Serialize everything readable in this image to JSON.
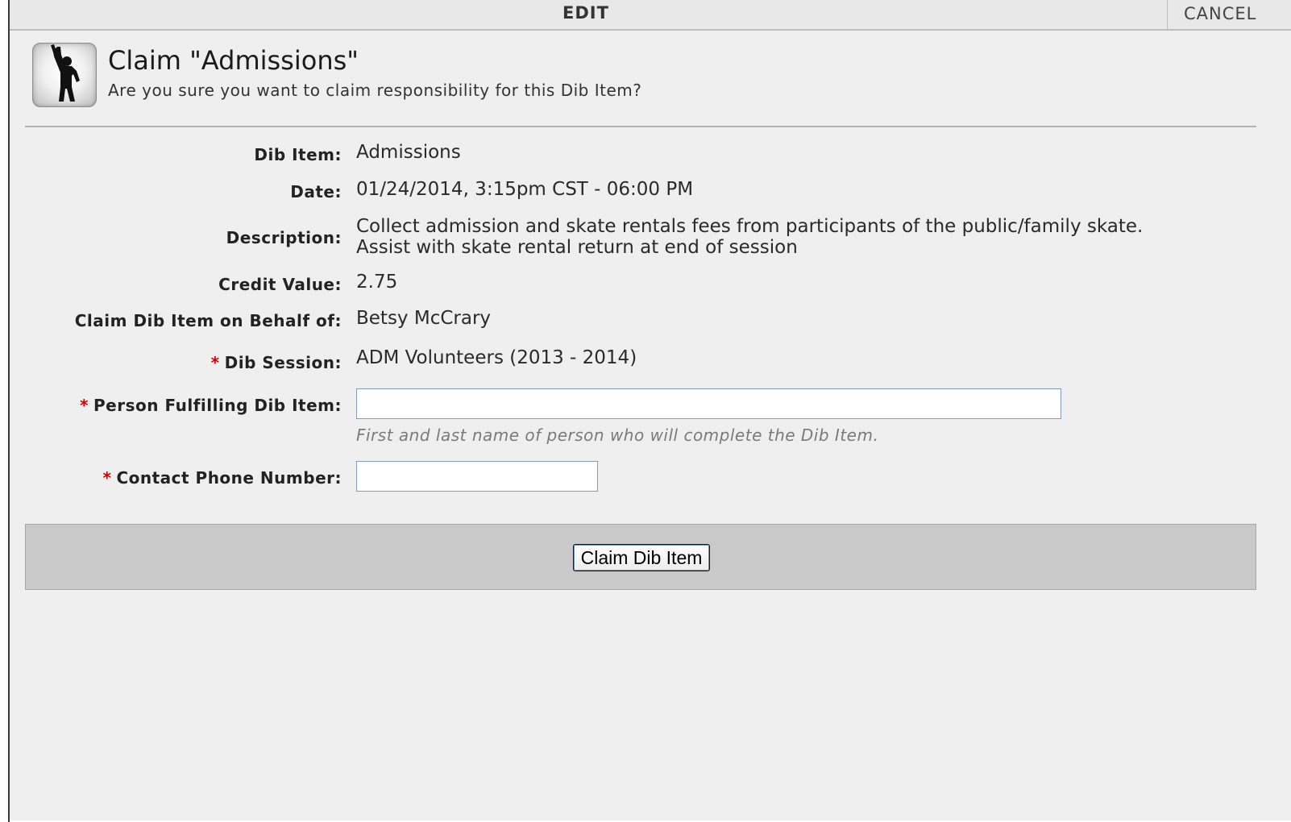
{
  "topbar": {
    "title": "EDIT",
    "cancel_label": "CANCEL"
  },
  "header": {
    "icon": "waving-person-icon",
    "title": "Claim \"Admissions\"",
    "subtitle": "Are you sure you want to claim responsibility for this Dib Item?"
  },
  "form": {
    "dib_item": {
      "label": "Dib Item:",
      "value": "Admissions"
    },
    "date": {
      "label": "Date:",
      "value": "01/24/2014, 3:15pm CST - 06:00 PM"
    },
    "description": {
      "label": "Description:",
      "value": "Collect admission and skate rentals fees from participants of the public/family skate. Assist with skate rental return at end of session"
    },
    "credit_value": {
      "label": "Credit Value:",
      "value": "2.75"
    },
    "behalf_of": {
      "label": "Claim Dib Item on Behalf of:",
      "value": "Betsy McCrary"
    },
    "dib_session": {
      "label": "Dib Session:",
      "value": "ADM Volunteers (2013 - 2014)",
      "required": true
    },
    "person_fulfilling": {
      "label": "Person Fulfilling Dib Item:",
      "value": "",
      "hint": "First and last name of person who will complete the Dib Item.",
      "required": true
    },
    "contact_phone": {
      "label": "Contact Phone Number:",
      "value": "",
      "required": true
    },
    "required_marker": "*"
  },
  "footer": {
    "submit_label": "Claim Dib Item"
  },
  "colors": {
    "required": "#d40000",
    "dialog_bg": "#efefef",
    "footer_bg": "#c9c9c9"
  }
}
